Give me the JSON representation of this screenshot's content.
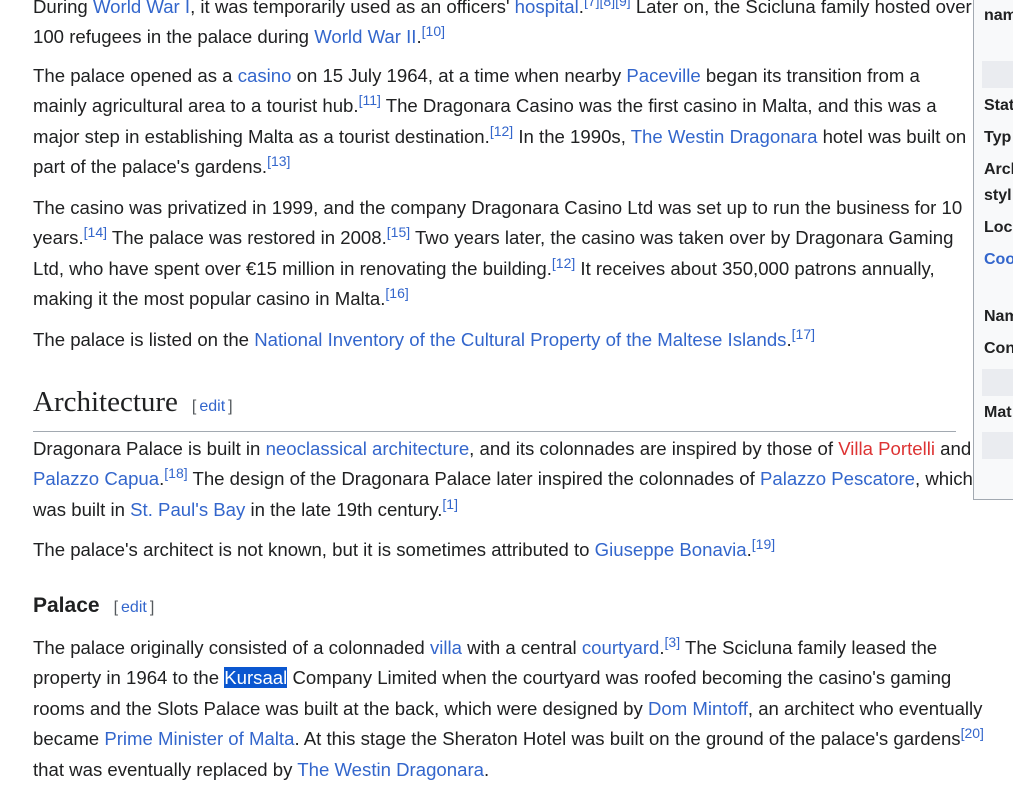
{
  "p1": {
    "t1": "During ",
    "l1": "World War I",
    "t2": ", it was temporarily used as an officers' ",
    "l2": "hospital",
    "t3": ".",
    "r1": "[7]",
    "r2": "[8]",
    "r3": "[9]",
    "t4": " Later on, the Scicluna family hosted over 100 refugees in the palace during ",
    "l3": "World War II",
    "t5": ".",
    "r4": "[10]"
  },
  "p2": {
    "t1": "The palace opened as a ",
    "l1": "casino",
    "t2": " on 15 July 1964, at a time when nearby ",
    "l2": "Paceville",
    "t3": " began its transition from a mainly agricultural area to a tourist hub.",
    "r1": "[11]",
    "t4": " The Dragonara Casino was the first casino in Malta, and this was a major step in establishing Malta as a tourist destination.",
    "r2": "[12]",
    "t5": " In the 1990s, ",
    "l3": "The Westin Dragonara",
    "t6": " hotel was built on part of the palace's gardens.",
    "r3": "[13]"
  },
  "p3": {
    "t1": "The casino was privatized in 1999, and the company Dragonara Casino Ltd was set up to run the business for 10 years.",
    "r1": "[14]",
    "t2": " The palace was restored in 2008.",
    "r2": "[15]",
    "t3": " Two years later, the casino was taken over by Dragonara Gaming Ltd, who have spent over €15 million in renovating the building.",
    "r3": "[12]",
    "t4": " It receives about 350,000 patrons annually, making it the most popular casino in Malta.",
    "r4": "[16]"
  },
  "p4": {
    "t1": "The palace is listed on the ",
    "l1": "National Inventory of the Cultural Property of the Maltese Islands",
    "t2": ".",
    "r1": "[17]"
  },
  "h_architecture": {
    "title": "Architecture",
    "edit_open": "[",
    "edit": "edit",
    "edit_close": "]"
  },
  "p5": {
    "t1": "Dragonara Palace is built in ",
    "l1": "neoclassical architecture",
    "t2": ", and its colonnades are inspired by those of ",
    "l2": "Villa Portelli",
    "t3": " and ",
    "l3": "Palazzo Capua",
    "t4": ".",
    "r1": "[18]",
    "t5": " The design of the Dragonara Palace later inspired the colonnades of ",
    "l4": "Palazzo Pescatore",
    "t6": ", which was built in ",
    "l5": "St. Paul's Bay",
    "t7": " in the late 19th century.",
    "r2": "[1]"
  },
  "p6": {
    "t1": "The palace's architect is not known, but it is sometimes attributed to ",
    "l1": "Giuseppe Bonavia",
    "t2": ".",
    "r1": "[19]"
  },
  "h_palace": {
    "title": "Palace",
    "edit_open": "[",
    "edit": "edit",
    "edit_close": "]"
  },
  "p7": {
    "t1": "The palace originally consisted of a colonnaded ",
    "l1": "villa",
    "t2": " with a central ",
    "l2": "courtyard",
    "t3": ".",
    "r1": "[3]",
    "t4": " The Scicluna family leased the property in 1964 to the ",
    "l3": "Kursaal",
    "t5": " Company Limited when the courtyard was roofed becoming the casino's gaming rooms and the Slots Palace was built at the back, which were designed by ",
    "l4": "Dom Mintoff",
    "t6": ", an architect who eventually became ",
    "l5": "Prime Minister of Malta",
    "t7": ". At this stage the Sheraton Hotel was built on the ground of the palace's gardens",
    "r2": "[20]",
    "t8": " that was eventually replaced by ",
    "l6": "The Westin Dragonara",
    "t9": "."
  },
  "infobox": {
    "name": "nam",
    "status": "Stat",
    "type": "Typ",
    "arch1": "Arch",
    "arch2": "styl",
    "location": "Loc",
    "coords": "Coo",
    "named": "Nam",
    "completed": "Con",
    "material": "Mat"
  },
  "colors": {
    "link": "#3366cc",
    "redlink": "#dd3333",
    "text": "#202122",
    "selection": "#0b57d0"
  }
}
